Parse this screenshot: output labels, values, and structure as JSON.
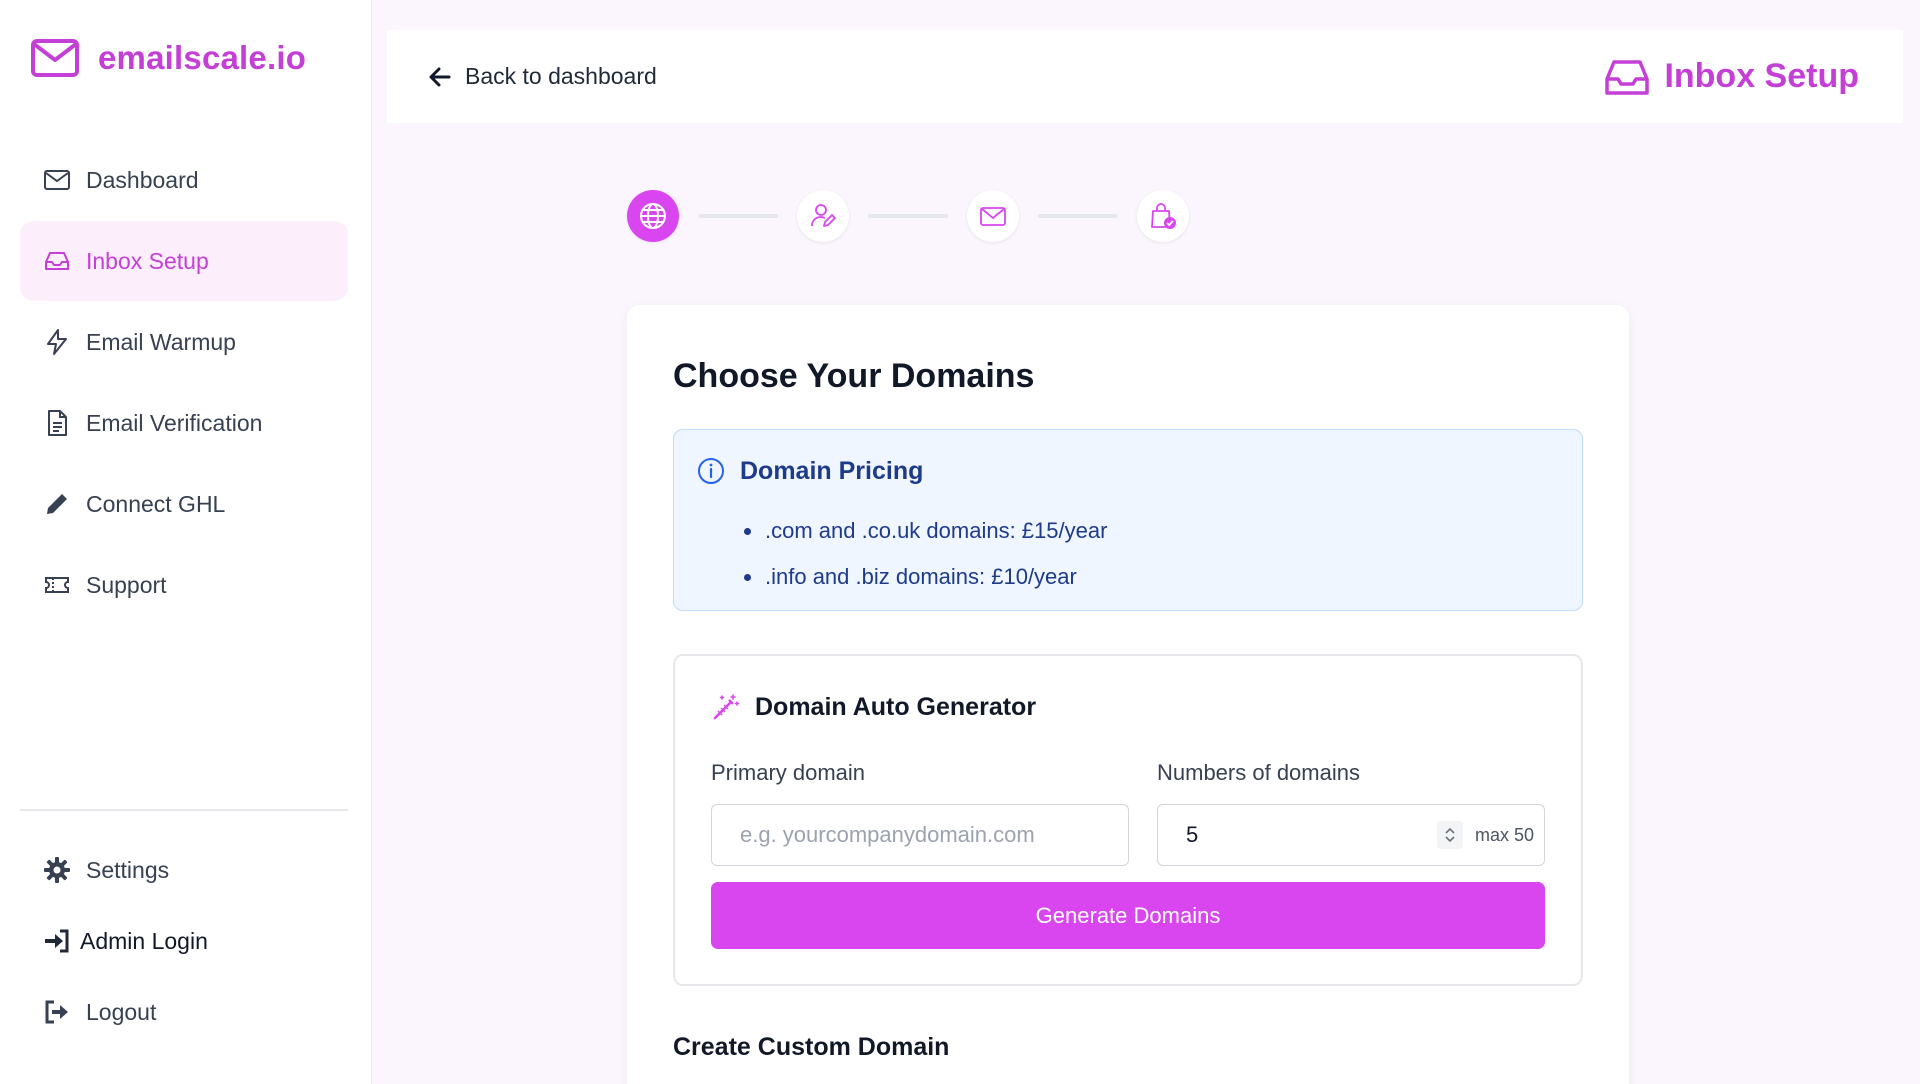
{
  "app": {
    "name": "emailscale.io",
    "brand_color": "#c43fd6",
    "accent_color": "#d946ef"
  },
  "sidebar": {
    "items": [
      {
        "label": "Dashboard",
        "icon": "envelope-icon"
      },
      {
        "label": "Inbox Setup",
        "icon": "inbox-icon",
        "active": true
      },
      {
        "label": "Email Warmup",
        "icon": "lightning-icon"
      },
      {
        "label": "Email Verification",
        "icon": "document-icon"
      },
      {
        "label": "Connect GHL",
        "icon": "pencil-icon"
      },
      {
        "label": "Support",
        "icon": "ticket-icon"
      }
    ],
    "bottom_items": [
      {
        "label": "Settings",
        "icon": "gear-icon"
      },
      {
        "label": "Admin Login",
        "icon": "sign-in-icon"
      },
      {
        "label": "Logout",
        "icon": "sign-out-icon"
      }
    ]
  },
  "header": {
    "back_label": "Back to dashboard",
    "title": "Inbox Setup"
  },
  "stepper": {
    "steps": [
      {
        "icon": "globe-icon",
        "active": true
      },
      {
        "icon": "user-edit-icon",
        "active": false
      },
      {
        "icon": "envelope-icon",
        "active": false
      },
      {
        "icon": "bag-check-icon",
        "active": false
      }
    ]
  },
  "main": {
    "title": "Choose Your Domains",
    "pricing": {
      "title": "Domain Pricing",
      "items": [
        ".com and .co.uk domains: £15/year",
        ".info and .biz domains: £10/year"
      ]
    },
    "generator": {
      "title": "Domain Auto Generator",
      "primary_label": "Primary domain",
      "primary_placeholder": "e.g. yourcompanydomain.com",
      "count_label": "Numbers of domains",
      "count_value": "5",
      "count_max": "max 50",
      "button_label": "Generate Domains"
    },
    "custom_title": "Create Custom Domain"
  }
}
